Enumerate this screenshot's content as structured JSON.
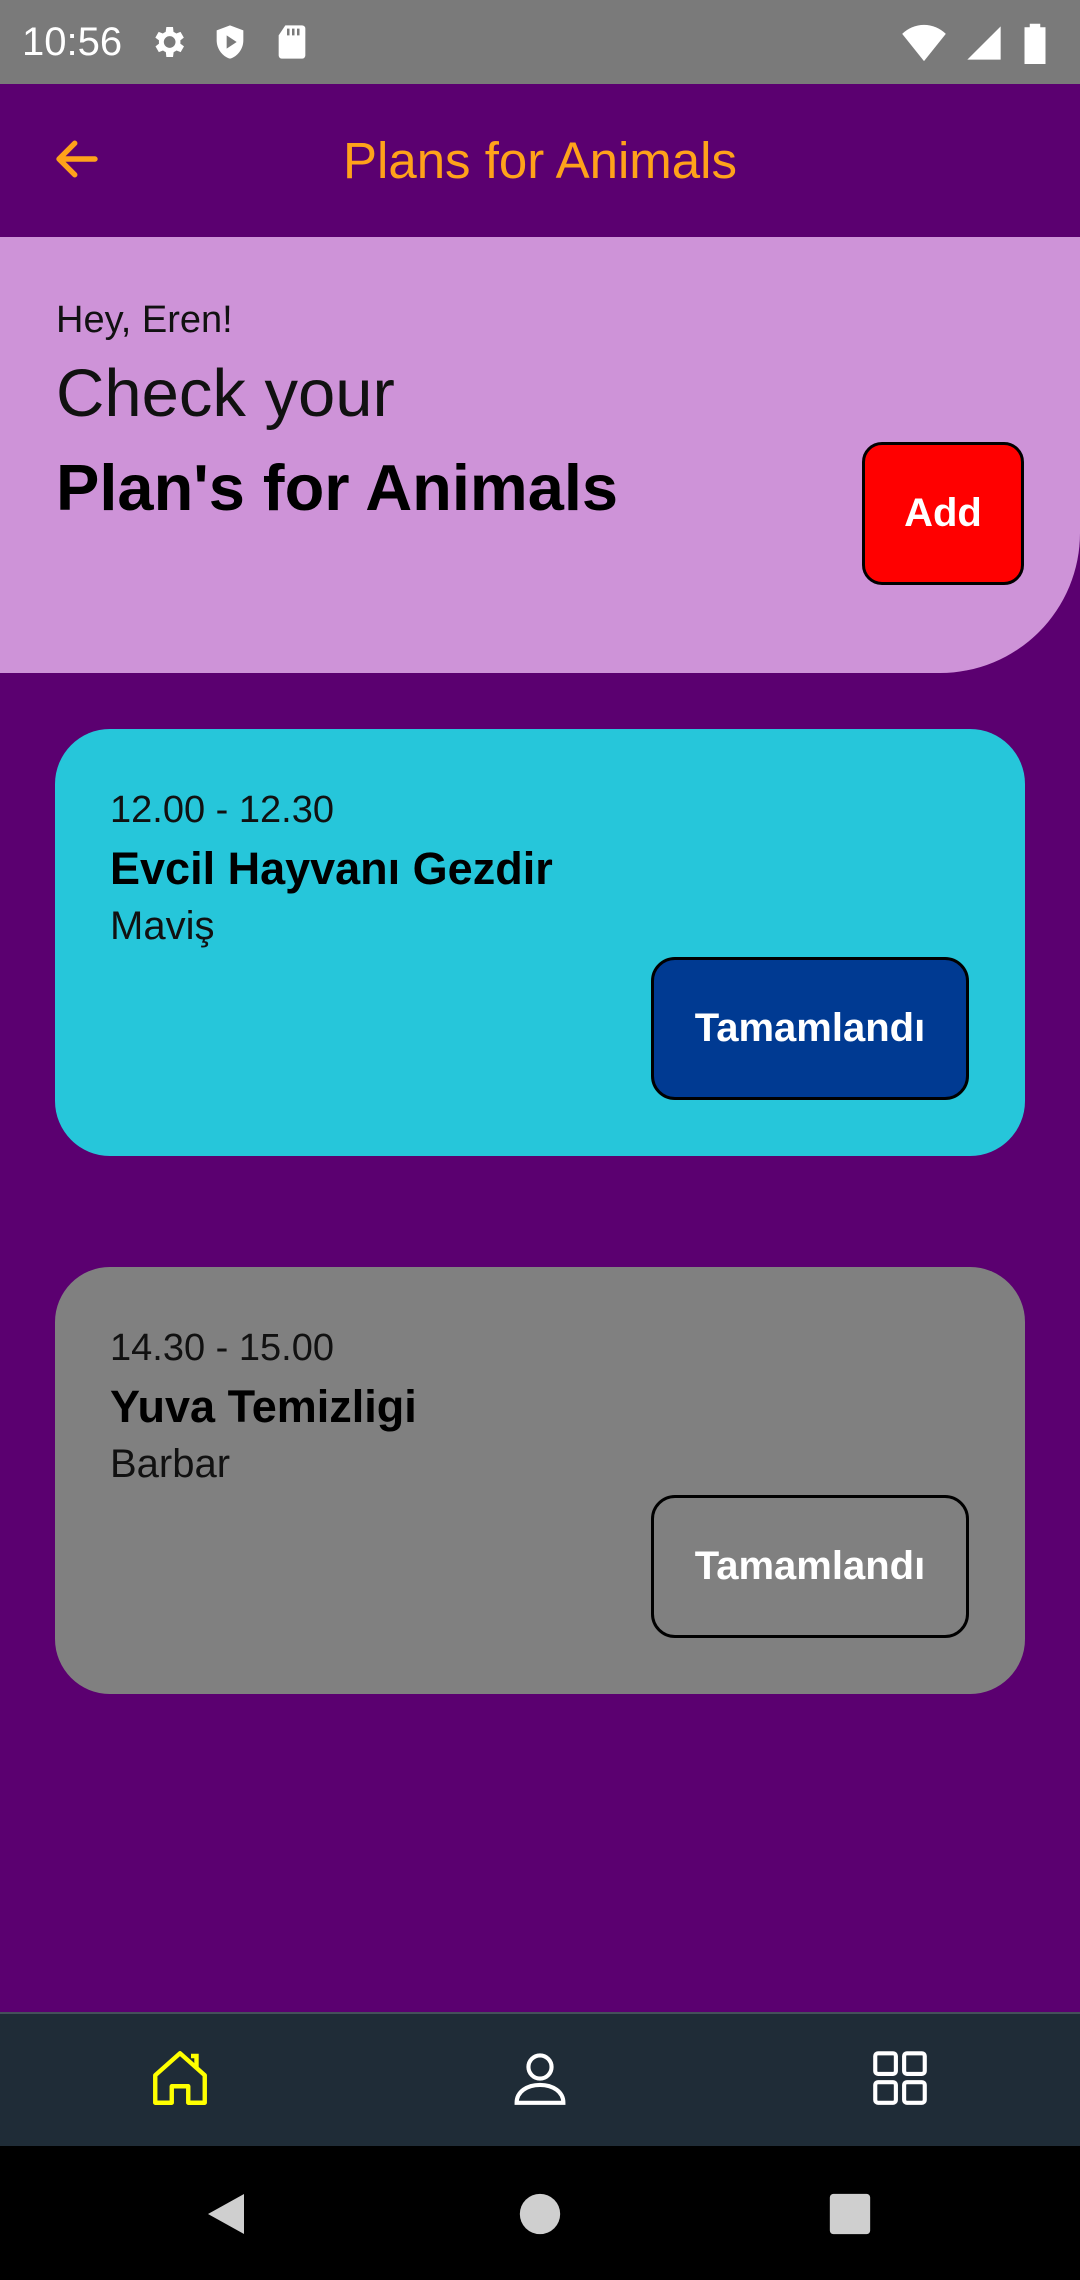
{
  "status_bar": {
    "time": "10:56",
    "icons_left": [
      "settings-icon",
      "shield-play-icon",
      "sd-card-icon"
    ],
    "icons_right": [
      "wifi-icon",
      "signal-icon",
      "battery-icon"
    ]
  },
  "app_bar": {
    "title": "Plans for Animals",
    "back_icon": "arrow-back-icon",
    "title_color": "#FFA21A"
  },
  "hero": {
    "greeting": "Hey, Eren!",
    "headline_line1": "Check your",
    "headline_line2": "Plan's for Animals",
    "add_label": "Add",
    "bg_color": "#CE93D8",
    "add_color": "#FF0000"
  },
  "plans": [
    {
      "time": "12.00 - 12.30",
      "title": "Evcil Hayvanı Gezdir",
      "pet": "Maviş",
      "button_label": "Tamamlandı",
      "card_color": "#26C6DA",
      "button_color": "#003A92"
    },
    {
      "time": "14.30 - 15.00",
      "title": "Yuva Temizligi",
      "pet": "Barbar",
      "button_label": "Tamamlandı",
      "card_color": "#808080",
      "button_color": "transparent"
    }
  ],
  "bottom_nav": {
    "items": [
      {
        "icon": "home-icon",
        "active": true
      },
      {
        "icon": "person-icon",
        "active": false
      },
      {
        "icon": "grid-icon",
        "active": false
      }
    ],
    "active_color": "#FFFF00",
    "inactive_color": "#FFFFFF"
  },
  "system_nav": [
    "back-triangle-icon",
    "home-circle-icon",
    "recents-square-icon"
  ],
  "colors": {
    "background": "#5B0070"
  }
}
